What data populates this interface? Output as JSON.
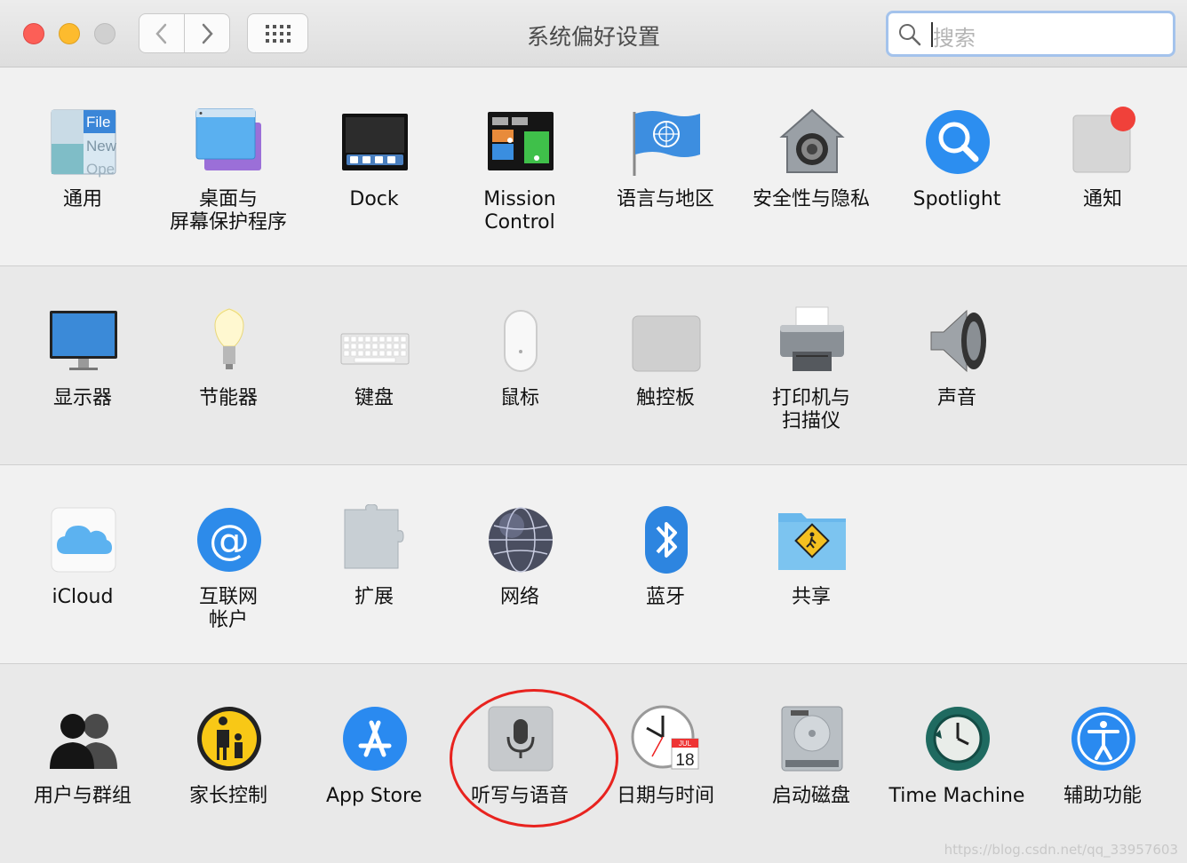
{
  "window": {
    "title": "系统偏好设置"
  },
  "search": {
    "placeholder": "搜索"
  },
  "rows": [
    [
      {
        "name": "general",
        "label": "通用"
      },
      {
        "name": "desktop-screensaver",
        "label": "桌面与\n屏幕保护程序"
      },
      {
        "name": "dock",
        "label": "Dock"
      },
      {
        "name": "mission-control",
        "label": "Mission\nControl"
      },
      {
        "name": "language-region",
        "label": "语言与地区"
      },
      {
        "name": "security-privacy",
        "label": "安全性与隐私"
      },
      {
        "name": "spotlight",
        "label": "Spotlight"
      },
      {
        "name": "notifications",
        "label": "通知"
      }
    ],
    [
      {
        "name": "displays",
        "label": "显示器"
      },
      {
        "name": "energy-saver",
        "label": "节能器"
      },
      {
        "name": "keyboard",
        "label": "键盘"
      },
      {
        "name": "mouse",
        "label": "鼠标"
      },
      {
        "name": "trackpad",
        "label": "触控板"
      },
      {
        "name": "printers-scanners",
        "label": "打印机与\n扫描仪"
      },
      {
        "name": "sound",
        "label": "声音"
      }
    ],
    [
      {
        "name": "icloud",
        "label": "iCloud"
      },
      {
        "name": "internet-accounts",
        "label": "互联网\n帐户"
      },
      {
        "name": "extensions",
        "label": "扩展"
      },
      {
        "name": "network",
        "label": "网络"
      },
      {
        "name": "bluetooth",
        "label": "蓝牙"
      },
      {
        "name": "sharing",
        "label": "共享"
      }
    ],
    [
      {
        "name": "users-groups",
        "label": "用户与群组"
      },
      {
        "name": "parental-controls",
        "label": "家长控制"
      },
      {
        "name": "app-store",
        "label": "App Store"
      },
      {
        "name": "dictation-speech",
        "label": "听写与语音"
      },
      {
        "name": "date-time",
        "label": "日期与时间"
      },
      {
        "name": "startup-disk",
        "label": "启动磁盘"
      },
      {
        "name": "time-machine",
        "label": "Time Machine"
      },
      {
        "name": "accessibility",
        "label": "辅助功能"
      }
    ]
  ],
  "icon_text": {
    "general_file": "File",
    "general_new": "New",
    "general_open": "Ope",
    "calendar_month": "JUL",
    "calendar_day": "18"
  },
  "watermark": "https://blog.csdn.net/qq_33957603",
  "colors": {
    "close": "#fc5f57",
    "minimize": "#fdbb2e",
    "zoom": "#d0d0d0",
    "notification_badge": "#f0413a",
    "annotation_circle": "#e8231f"
  }
}
